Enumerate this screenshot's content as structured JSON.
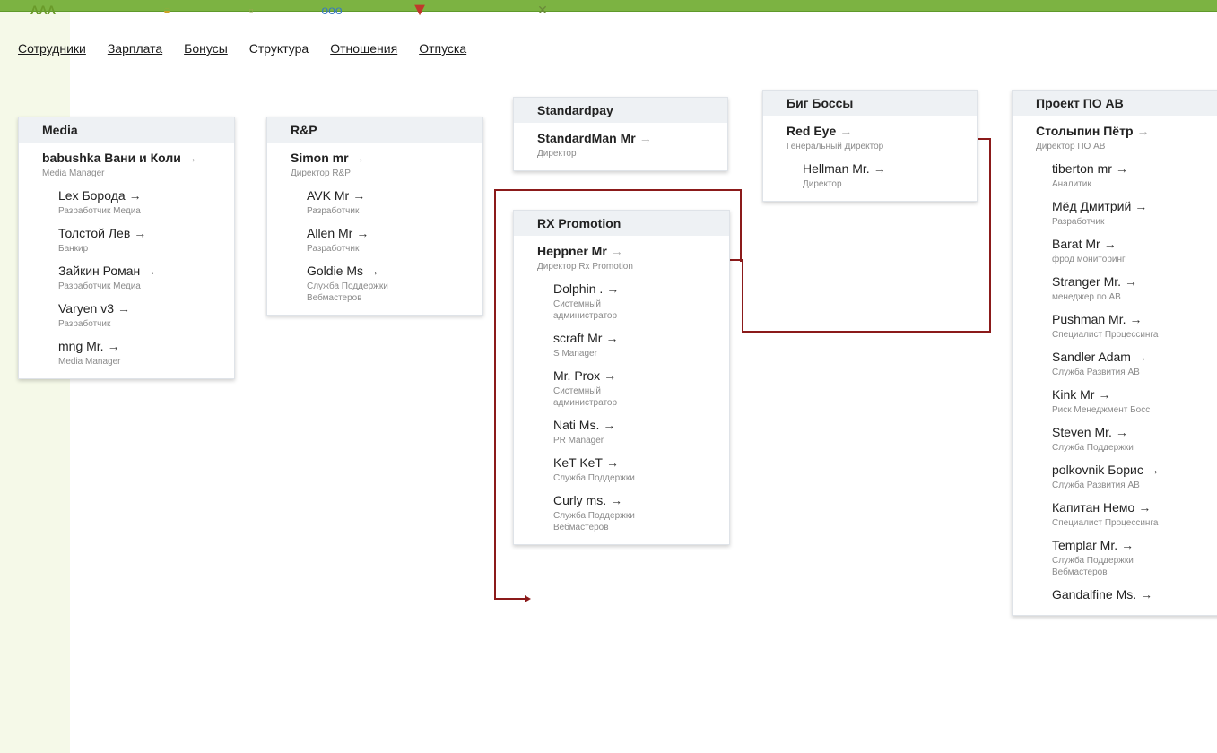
{
  "nav": {
    "tabs": [
      {
        "label": "Сотрудники",
        "active": false
      },
      {
        "label": "Зарплата",
        "active": false
      },
      {
        "label": "Бонусы",
        "active": false
      },
      {
        "label": "Структура",
        "active": true
      },
      {
        "label": "Отношения",
        "active": false
      },
      {
        "label": "Отпуска",
        "active": false
      }
    ],
    "icons": [
      "people-icon",
      "coins-icon",
      "bag-icon",
      "structure-icon",
      "heart-icon",
      "beach-icon"
    ]
  },
  "colors": {
    "topbar": "#7cb342",
    "connector": "#8b1a1a"
  },
  "departments": [
    {
      "title": "Media",
      "head": {
        "name": "babushka Вани и Коли",
        "role": "Media Manager"
      },
      "employees": [
        {
          "name": "Lex Борода",
          "role": "Разработчик Медиа"
        },
        {
          "name": "Толстой Лев",
          "role": "Банкир"
        },
        {
          "name": "Зайкин Роман",
          "role": "Разработчик Медиа"
        },
        {
          "name": "Varyen v3",
          "role": "Разработчик"
        },
        {
          "name": "mng Mr.",
          "role": "Media Manager"
        }
      ]
    },
    {
      "title": "R&P",
      "head": {
        "name": "Simon mr",
        "role": "Директор R&P"
      },
      "employees": [
        {
          "name": "AVK Mr",
          "role": "Разработчик"
        },
        {
          "name": "Allen Mr",
          "role": "Разработчик"
        },
        {
          "name": "Goldie Ms",
          "role": "Служба Поддержки Вебмастеров"
        }
      ]
    },
    {
      "title": "Standardpay",
      "head": {
        "name": "StandardMan Mr",
        "role": "Директор"
      },
      "employees": []
    },
    {
      "title": "RX Promotion",
      "head": {
        "name": "Heppner Mr",
        "role": "Директор Rx Promotion"
      },
      "employees": [
        {
          "name": "Dolphin .",
          "role": "Системный администратор"
        },
        {
          "name": "scraft Mr",
          "role": "S Manager"
        },
        {
          "name": "Mr. Prox",
          "role": "Системный администратор"
        },
        {
          "name": "Nati Ms.",
          "role": "PR Manager"
        },
        {
          "name": "KeT KeT",
          "role": "Служба Поддержки"
        },
        {
          "name": "Curly ms.",
          "role": "Служба Поддержки Вебмастеров"
        }
      ]
    },
    {
      "title": "Биг Боссы",
      "head": {
        "name": "Red Eye",
        "role": "Генеральный Директор"
      },
      "employees": [
        {
          "name": "Hellman Mr.",
          "role": "Директор"
        }
      ]
    },
    {
      "title": "Проект ПО АВ",
      "head": {
        "name": "Столыпин Пётр",
        "role": "Директор ПО АВ"
      },
      "employees": [
        {
          "name": "tiberton mr",
          "role": "Аналитик"
        },
        {
          "name": "Мёд Дмитрий",
          "role": "Разработчик"
        },
        {
          "name": "Barat Mr",
          "role": "фрод мониторинг"
        },
        {
          "name": "Stranger Mr.",
          "role": "менеджер по АВ"
        },
        {
          "name": "Pushman Mr.",
          "role": "Специалист Процессинга"
        },
        {
          "name": "Sandler Adam",
          "role": "Служба Развития АВ"
        },
        {
          "name": "Kink Mr",
          "role": "Риск Менеджмент Босс"
        },
        {
          "name": "Steven Mr.",
          "role": "Служба Поддержки"
        },
        {
          "name": "polkovnik Борис",
          "role": "Служба Развития АВ"
        },
        {
          "name": "Капитан Немо",
          "role": "Специалист Процессинга"
        },
        {
          "name": "Templar Mr.",
          "role": "Служба Поддержки Вебмастеров"
        },
        {
          "name": "Gandalfine Ms.",
          "role": ""
        }
      ]
    }
  ]
}
